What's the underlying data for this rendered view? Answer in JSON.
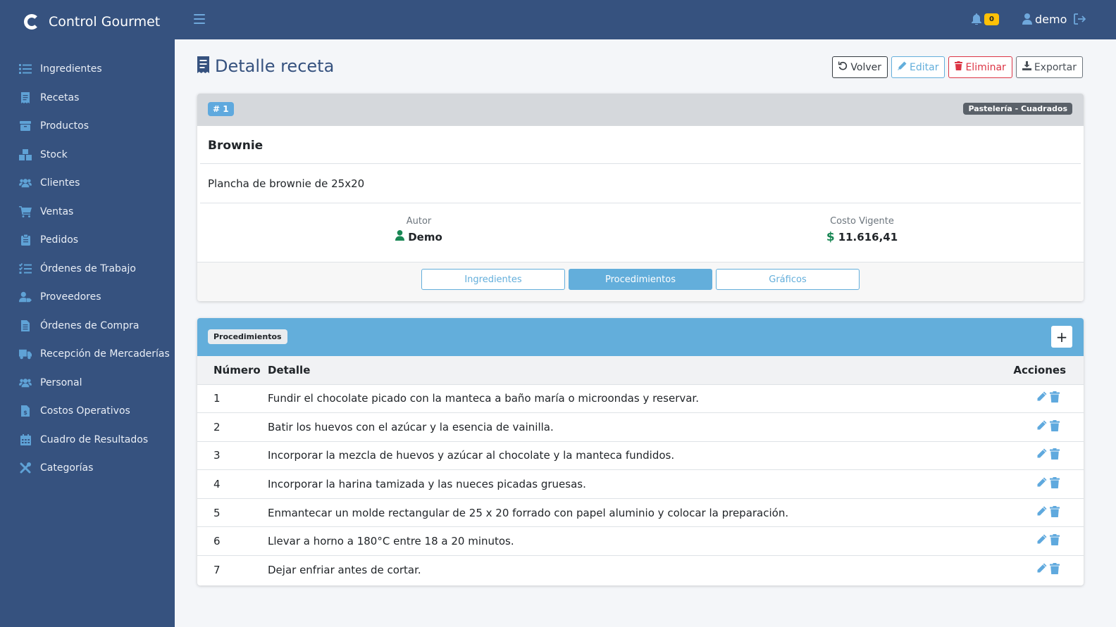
{
  "app": {
    "name": "Control Gourmet"
  },
  "sidebar": {
    "items": [
      {
        "label": "Ingredientes",
        "icon": "list-icon"
      },
      {
        "label": "Recetas",
        "icon": "receipt-icon"
      },
      {
        "label": "Productos",
        "icon": "box-icon"
      },
      {
        "label": "Stock",
        "icon": "boxes-icon"
      },
      {
        "label": "Clientes",
        "icon": "users-icon"
      },
      {
        "label": "Ventas",
        "icon": "cart-icon"
      },
      {
        "label": "Pedidos",
        "icon": "clipboard-icon"
      },
      {
        "label": "Órdenes de Trabajo",
        "icon": "tasks-icon"
      },
      {
        "label": "Proveedores",
        "icon": "user-tag-icon"
      },
      {
        "label": "Órdenes de Compra",
        "icon": "file-icon"
      },
      {
        "label": "Recepción de Mercaderías",
        "icon": "truck-icon"
      },
      {
        "label": "Personal",
        "icon": "users-icon"
      },
      {
        "label": "Costos Operativos",
        "icon": "invoice-icon"
      },
      {
        "label": "Cuadro de Resultados",
        "icon": "calendar-icon"
      },
      {
        "label": "Categorías",
        "icon": "tools-icon"
      }
    ]
  },
  "topbar": {
    "notifications": "0",
    "user": "demo"
  },
  "page": {
    "title": "Detalle receta"
  },
  "actions": {
    "back": "Volver",
    "edit": "Editar",
    "delete": "Eliminar",
    "export": "Exportar"
  },
  "recipe": {
    "id": "# 1",
    "category": "Pastelería - Cuadrados",
    "name": "Brownie",
    "description": "Plancha de brownie de 25x20",
    "author_label": "Autor",
    "author": "Demo",
    "cost_label": "Costo Vigente",
    "cost": "11.616,41"
  },
  "tabs": [
    "Ingredientes",
    "Procedimientos",
    "Gráficos"
  ],
  "procedures": {
    "badge": "Procedimientos",
    "add": "+",
    "columns": {
      "num": "Número",
      "detail": "Detalle",
      "actions": "Acciones"
    },
    "rows": [
      {
        "num": "1",
        "detail": "Fundir el chocolate picado con la manteca a baño maría o microondas y reservar."
      },
      {
        "num": "2",
        "detail": "Batir los huevos con el azúcar y la esencia de vainilla."
      },
      {
        "num": "3",
        "detail": "Incorporar la mezcla de huevos y azúcar al chocolate y la manteca fundidos."
      },
      {
        "num": "4",
        "detail": "Incorporar la harina tamizada y las nueces picadas gruesas."
      },
      {
        "num": "5",
        "detail": "Enmantecar un molde rectangular de 25 x 20 forrado con papel aluminio y colocar la preparación."
      },
      {
        "num": "6",
        "detail": "Llevar a horno a 180°C entre 18 a 20 minutos."
      },
      {
        "num": "7",
        "detail": "Dejar enfriar antes de cortar."
      }
    ]
  },
  "colors": {
    "sidebar": "#36527f",
    "accent": "#63aedb",
    "danger": "#dc3545",
    "warning": "#ffc107",
    "success": "#198754"
  }
}
